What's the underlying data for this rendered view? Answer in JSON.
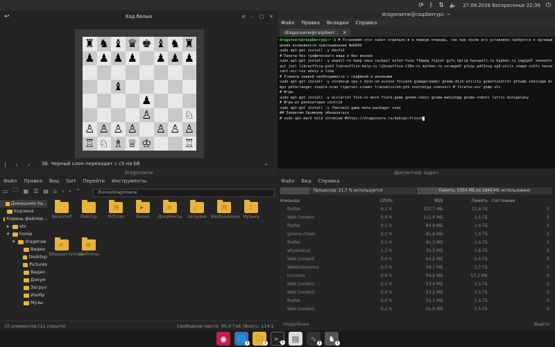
{
  "top_panel": {
    "datetime": "27.09.2026 Воскресенье 22:39"
  },
  "chess": {
    "title": "Ход белых",
    "status": "36. Черный слон переходит с c5 на b6",
    "board": [
      [
        "♜",
        "♞",
        "♝",
        "♛",
        "♚",
        "♝",
        "♞",
        "♜"
      ],
      [
        "♟",
        "♟",
        "♟",
        "♟",
        "",
        "♟",
        "♟",
        "♟"
      ],
      [
        "",
        "",
        "",
        "",
        "",
        "",
        "",
        ""
      ],
      [
        "",
        "",
        "♝",
        "",
        "",
        "",
        "",
        ""
      ],
      [
        "",
        "",
        "",
        "",
        "♟",
        "",
        "",
        ""
      ],
      [
        "",
        "",
        "",
        "",
        "♙",
        "",
        "",
        ""
      ],
      [
        "",
        "",
        "",
        "",
        "",
        "",
        "",
        "♘"
      ],
      [
        "♙",
        "♙",
        "♙",
        "♙",
        "",
        "♙",
        "♙",
        "♙"
      ],
      [
        "♖",
        "♘",
        "♗",
        "♕",
        "♔",
        "",
        "",
        "♖"
      ]
    ]
  },
  "terminal": {
    "title": "dragonserw@raspberrypi: ~",
    "menu": [
      "Файл",
      "Правка",
      "Вкладки",
      "Справка"
    ],
    "tab": "dragonserw@raspberr...",
    "prompt": "dragonserw@raspberrypi:~ $",
    "lines": [
      " # Установим этот пакет отдельно и в первую очередь, так как после его установки требуется п одтверждения возможности присоединения WebDAV",
      "sudo apt-get install -y davfs2",
      "# Пакеты без графического вида и без иконок",
      "sudo apt-get install -y aspell-ru beep cmus cockpit exfat-fuse ffmpeg figlet gvfs hplip hunspell-ru hyphen-ru img2pdf innoextract jnxl libreoffice-gtk3 libreoffice-help-ru libreoffice-l10n-ru mythes-ru ocrmypdf pfzip pdf2svg sg3-utils snapd sshfs tesseract-ocr-rus whois ≥ lshw",
      "# Утилиты первой необходимости с графикой и иконками",
      "sudo apt-get install -y chromium cpu-x dino-im evince foliate gimagereader gnome-disk-utility gsmartcontrol gthumb inkscape mc mpv pdfarranger simple-scan tigervnc-viewer transmission-gtk xournalpp xsensors # firefox-esr gimp vlc",
      "# Игры",
      "sudo apt-get install -y aisleriot five-or-more flare-game gnome-chess gnome-mahjongg gnome-robots lutris minigalaxy",
      "# Игры из репозитория contrib",
      "sudo apt-get install -y fheroes2 game-data-packager vcmi",
      "## Запретим Хромиуму обновляться",
      "# sudo apt-mark hold chromium #https://dragonserw.ru/debian:frixid"
    ]
  },
  "filemanager": {
    "title": "dragonserw",
    "menu": [
      "Файл",
      "Правка",
      "Вид",
      "Sort",
      "Перейти",
      "Инструменты"
    ],
    "path": "/home/dragonserw",
    "sidebar": [
      "Домашняя па...",
      "Корзина",
      "Корень файлов...",
      "etc",
      "home",
      "dragonse",
      "Видео",
      "Desktop",
      "Pictures",
      "Видео",
      "Докум",
      "Загруз",
      "Изобр",
      "Музы"
    ],
    "items": [
      "Bookshelf",
      "Desktop",
      "Pictures",
      "Видео",
      "Документы",
      "Загрузки",
      "Изображения",
      "Музыка",
      "Общедоступные",
      "Шаблоны"
    ],
    "status_left": "10 элементов (11 скрыто)",
    "status_right": "Свободное место: 95,9 ГиБ (Всего: 114,1 ГиБ)"
  },
  "taskmanager": {
    "title": "Диспетчер задач",
    "menu": [
      "Файл",
      "Вид",
      "Справка"
    ],
    "cpu": "Процессор: 21,7 % используется",
    "cpu_fraction": 0.217,
    "mem": "Память: 1054 МБ из 1844 МБ использовано",
    "mem_fraction": 0.572,
    "headers": [
      "Команда",
      "CPU%",
      "RSS",
      "Память",
      "Состояние"
    ],
    "rows": [
      [
        "firefox",
        "0,1 %",
        "322,7 МБ",
        "11,8 ГБ",
        "S"
      ],
      [
        "Web Content",
        "0,0 %",
        "111,4 МБ",
        "2,5 ГБ",
        "S"
      ],
      [
        "firefox",
        "0,1 %",
        "84,9 МБ",
        "2,6 ГБ",
        "S"
      ],
      [
        "gnome-chess",
        "0,1 %",
        "81,8 МБ",
        "1,0 ГБ",
        "S"
      ],
      [
        "firefox",
        "0,1 %",
        "81,3 МБ",
        "2,6 ГБ",
        "S"
      ],
      [
        "wf-panel-pi",
        "1,1 %",
        "76,3 МБ",
        "1,6 ГБ",
        "S"
      ],
      [
        "Web Content",
        "0,0 %",
        "63,2 МБ",
        "2,5 ГБ",
        "S"
      ],
      [
        "WebExtensions",
        "0,5 %",
        "59,1 МБ",
        "2,7 ГБ",
        "S"
      ],
      [
        "hicchess",
        "0,0 %",
        "54,6 МБ",
        "57,3 МБ",
        "S"
      ],
      [
        "Web Content",
        "0,1 %",
        "53,4 МБ",
        "2,5 ГБ",
        "S"
      ],
      [
        "Web Content",
        "0,0 %",
        "53,2 МБ",
        "2,5 ГБ",
        "S"
      ],
      [
        "firefox",
        "0,0 %",
        "52,1 МБ",
        "2,6 ГБ",
        "S"
      ],
      [
        "Web Content",
        "0,1 %",
        "51,0 МБ",
        "2,5 ГБ",
        "S"
      ]
    ],
    "foot_left": "подробнее",
    "foot_right": "Выйти"
  }
}
